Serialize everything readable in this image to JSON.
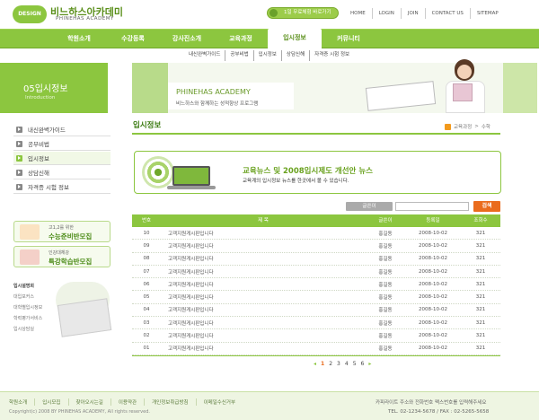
{
  "logo": {
    "badge": "DESIGN",
    "title": "비느하스아카데미",
    "subtitle": "PHINEHAS ACADEMY"
  },
  "promo_pill": "1일 무료체험 바로가기",
  "top_menu": [
    "HOME",
    "LOGIN",
    "JOIN",
    "CONTACT US",
    "SITEMAP"
  ],
  "main_nav": [
    {
      "label": "학원소개",
      "active": false
    },
    {
      "label": "수강등록",
      "active": false
    },
    {
      "label": "강사진소개",
      "active": false
    },
    {
      "label": "교육과정",
      "active": false
    },
    {
      "label": "입시정보",
      "active": true
    },
    {
      "label": "커뮤니티",
      "active": false
    }
  ],
  "sub_nav": [
    "내신완벽가이드",
    "공부비법",
    "입시정보",
    "상담신해",
    "자격증 시험 정보"
  ],
  "side_banner": {
    "title": "05입시정보",
    "subtitle": "Introduction"
  },
  "side_menu": [
    {
      "label": "내신완벽가이드",
      "active": false
    },
    {
      "label": "공부비법",
      "active": false
    },
    {
      "label": "입시정보",
      "active": true
    },
    {
      "label": "상담신해",
      "active": false
    },
    {
      "label": "자격증 시험 정보",
      "active": false
    }
  ],
  "promo_boxes": [
    {
      "small": "고1,2를 위한",
      "big": "수능준비반모집",
      "color": "#f29a1d"
    },
    {
      "small": "인강대체강",
      "big": "특강학습반모집",
      "color": "#d94a3a"
    }
  ],
  "quick_links": {
    "head": "입시설명회",
    "items": [
      "대입포커스",
      "대학별입시정보",
      "학력평가서비스",
      "입시상담실"
    ]
  },
  "hero": {
    "title": "PHINEHAS ACADEMY",
    "subtitle": "비느하스와 함께하는 성적향상 프로그램"
  },
  "page_title": "입시정보",
  "breadcrumb": [
    "교육과정",
    "수학"
  ],
  "notice": {
    "title": "교육뉴스 및 2008입시제도 개선안 뉴스",
    "subtitle": "교육계의 입시정보 뉴스를 한곳에서 볼 수 있습니다."
  },
  "search": {
    "select_label": "글쓴이",
    "input_value": "",
    "button_label": "검색"
  },
  "table": {
    "headers": {
      "num": "번호",
      "title": "제 목",
      "author": "글쓴이",
      "date": "등록일",
      "views": "조회수"
    },
    "rows": [
      {
        "num": "10",
        "title": "고객지원게시판입니다",
        "author": "홍길동",
        "date": "2008-10-02",
        "views": "321"
      },
      {
        "num": "09",
        "title": "고객지원게시판입니다",
        "author": "홍길동",
        "date": "2008-10-02",
        "views": "321"
      },
      {
        "num": "08",
        "title": "고객지원게시판입니다",
        "author": "홍길동",
        "date": "2008-10-02",
        "views": "321"
      },
      {
        "num": "07",
        "title": "고객지원게시판입니다",
        "author": "홍길동",
        "date": "2008-10-02",
        "views": "321"
      },
      {
        "num": "06",
        "title": "고객지원게시판입니다",
        "author": "홍길동",
        "date": "2008-10-02",
        "views": "321"
      },
      {
        "num": "05",
        "title": "고객지원게시판입니다",
        "author": "홍길동",
        "date": "2008-10-02",
        "views": "321"
      },
      {
        "num": "04",
        "title": "고객지원게시판입니다",
        "author": "홍길동",
        "date": "2008-10-02",
        "views": "321"
      },
      {
        "num": "03",
        "title": "고객지원게시판입니다",
        "author": "홍길동",
        "date": "2008-10-02",
        "views": "321"
      },
      {
        "num": "02",
        "title": "고객지원게시판입니다",
        "author": "홍길동",
        "date": "2008-10-02",
        "views": "321"
      },
      {
        "num": "01",
        "title": "고객지원게시판입니다",
        "author": "홍길동",
        "date": "2008-10-02",
        "views": "321"
      }
    ]
  },
  "pagination": {
    "prev": "◂",
    "next": "▸",
    "pages": [
      "1",
      "2",
      "3",
      "4",
      "5",
      "6"
    ],
    "current": "1"
  },
  "footer": {
    "links": [
      "학원소개",
      "입시모집",
      "찾아오시는길",
      "이용약관",
      "개인정보취급방침",
      "이메일수신거부"
    ],
    "copyright": "Copyright(c) 2008 BY PHINEHAS ACADEMY, All rights reserved.",
    "address": "카피라이트 주소와 전화번호 팩스번호를 입력해주세요",
    "tel": "TEL. 02-1234-5678 / FAX : 02-5265-5658"
  },
  "colors": {
    "brand_green": "#8cc63f",
    "dark_green": "#5a8f1a",
    "accent_orange": "#ea6c1d"
  }
}
